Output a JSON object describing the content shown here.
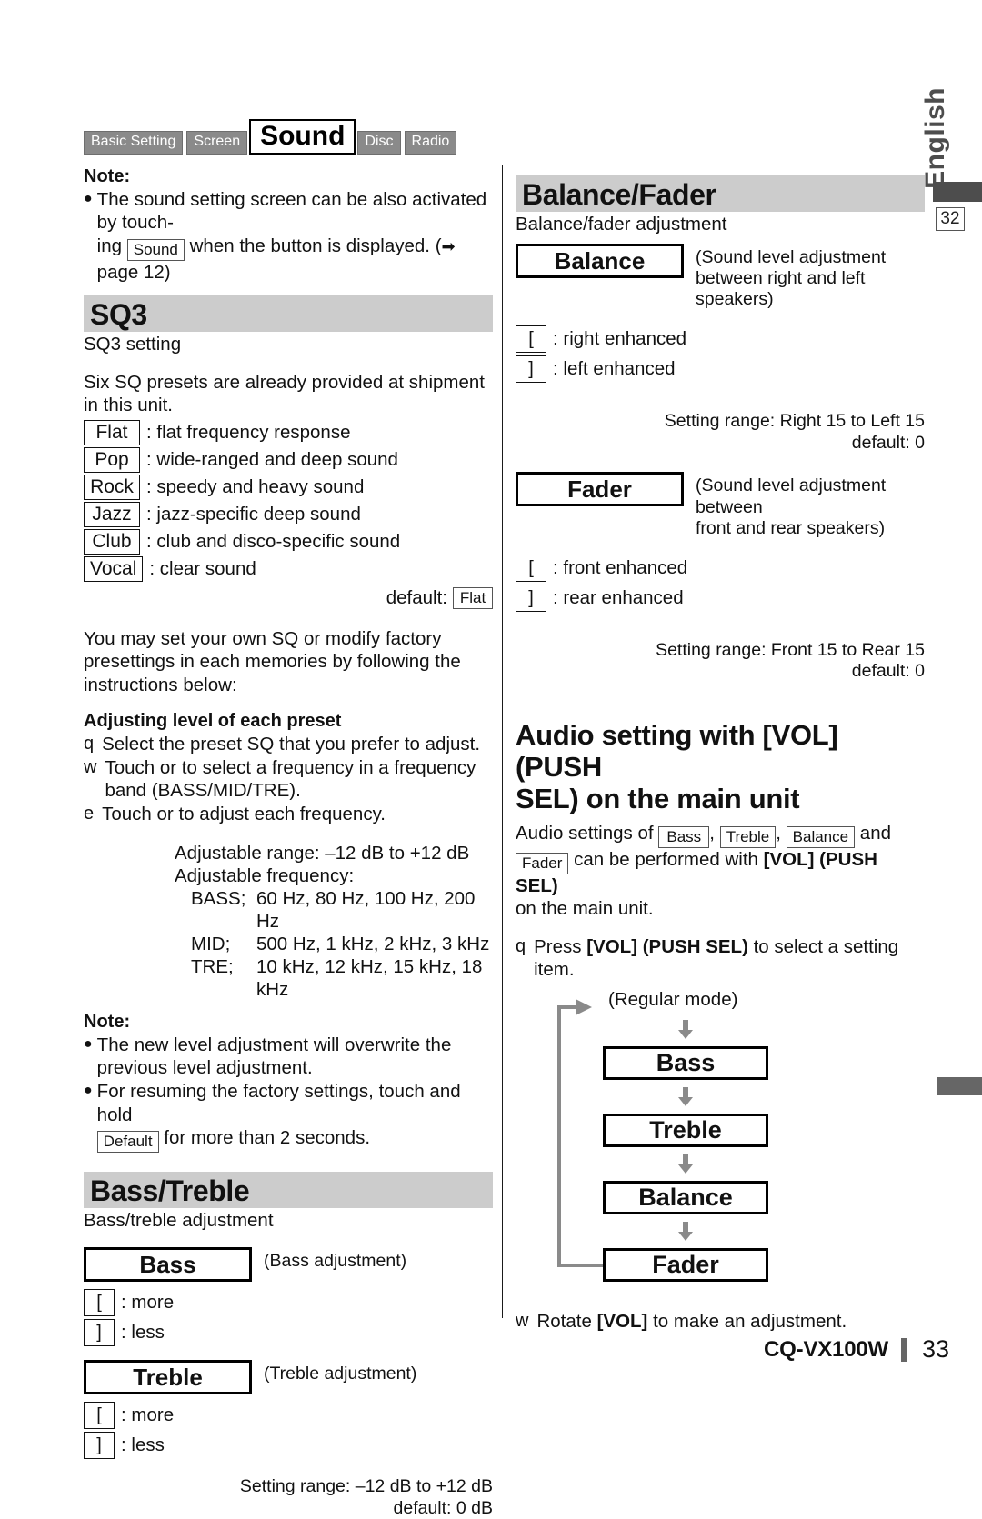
{
  "edge": {
    "language_label": "English",
    "page_ref_box": "32"
  },
  "nav_tabs": [
    {
      "label": "Basic Setting",
      "active": false
    },
    {
      "label": "Screen",
      "active": false
    },
    {
      "label": "Sound",
      "active": true
    },
    {
      "label": "Disc",
      "active": false
    },
    {
      "label": "Radio",
      "active": false
    }
  ],
  "left_column": {
    "note_top": {
      "heading": "Note:",
      "bullet_part1": "The sound setting screen can be also activated by touch-",
      "bullet_part2_pre": "ing",
      "bullet_chip": "Sound",
      "bullet_part2_post": "when the button is displayed. (",
      "arrow_icon": "➡",
      "bullet_part2_end": "page 12)"
    },
    "sq3": {
      "title": "SQ3",
      "subtitle": "SQ3 setting",
      "intro": "Six SQ presets are already provided at shipment in this unit.",
      "presets": [
        {
          "key": "Flat",
          "desc": ": flat frequency response"
        },
        {
          "key": "Pop",
          "desc": ": wide-ranged and deep sound"
        },
        {
          "key": "Rock",
          "desc": ": speedy and heavy sound"
        },
        {
          "key": "Jazz",
          "desc": ": jazz-specific deep sound"
        },
        {
          "key": "Club",
          "desc": ": club and disco-specific sound"
        },
        {
          "key": "Vocal",
          "desc": ": clear sound"
        }
      ],
      "default_label": "default:",
      "default_value": "Flat",
      "own_sq_text": "You may set your own SQ or modify factory presettings in each memories by following the instructions below:",
      "adjust_heading": "Adjusting level of each preset",
      "steps": [
        {
          "num": "q",
          "text": "Select the preset SQ that you prefer to adjust."
        },
        {
          "num": "w",
          "text": "Touch            or            to select a frequency in a frequency band (BASS/MID/TRE)."
        },
        {
          "num": "e",
          "text": "Touch            or            to adjust each frequency."
        }
      ],
      "adjustable_range": "Adjustable range: –12 dB to +12 dB",
      "adjustable_frequency_label": "Adjustable frequency:",
      "freq_rows": [
        {
          "band": "BASS;",
          "values": "60 Hz, 80 Hz, 100 Hz, 200 Hz"
        },
        {
          "band": "MID;",
          "values": "500 Hz, 1 kHz, 2 kHz, 3 kHz"
        },
        {
          "band": "TRE;",
          "values": "10 kHz, 12 kHz, 15 kHz, 18 kHz"
        }
      ],
      "note_bottom": {
        "heading": "Note:",
        "bullet1": "The new level adjustment will overwrite the previous level adjustment.",
        "bullet2_pre": "For resuming the factory settings, touch and hold",
        "bullet2_chip": "Default",
        "bullet2_post": "for more than 2 seconds."
      }
    },
    "bass_treble": {
      "title": "Bass/Treble",
      "subtitle": "Bass/treble adjustment",
      "bass_button": "Bass",
      "bass_caption": "(Bass adjustment)",
      "bass_more": ": more",
      "bass_less": ": less",
      "treble_button": "Treble",
      "treble_caption": "(Treble adjustment)",
      "treble_more": ": more",
      "treble_less": ": less",
      "range_line1": "Setting range: –12 dB to +12 dB",
      "range_line2": "default: 0 dB",
      "up_glyph": "[",
      "down_glyph": "]"
    }
  },
  "right_column": {
    "balance_fader": {
      "title": "Balance/Fader",
      "subtitle": "Balance/fader adjustment",
      "balance_button": "Balance",
      "balance_caption_line1": "(Sound level adjustment",
      "balance_caption_line2": "between right and left speakers)",
      "balance_right": ": right enhanced",
      "balance_left": ": left enhanced",
      "balance_range_line1": "Setting range: Right 15 to Left 15",
      "balance_range_line2": "default: 0",
      "fader_button": "Fader",
      "fader_caption_line1": "(Sound level adjustment between",
      "fader_caption_line2": "front and rear speakers)",
      "fader_front": ": front enhanced",
      "fader_rear": ": rear enhanced",
      "fader_range_line1": "Setting range: Front 15 to Rear 15",
      "fader_range_line2": "default: 0",
      "up_glyph": "[",
      "down_glyph": "]"
    },
    "vol_section": {
      "title_line1": "Audio setting with [VOL] (PUSH",
      "title_line2": "SEL) on the main unit",
      "intro_pre": "Audio settings of",
      "chip_bass": "Bass",
      "comma1": ",",
      "chip_treble": "Treble",
      "comma2": ",",
      "chip_balance": "Balance",
      "intro_and": "and",
      "chip_fader": "Fader",
      "intro_mid": "can be performed with",
      "intro_bold": "[VOL] (PUSH SEL)",
      "intro_end": "on the main unit.",
      "step1_num": "q",
      "step1_pre": "Press",
      "step1_bold": "[VOL] (PUSH SEL)",
      "step1_post": "to select a setting item.",
      "regular_mode": "(Regular mode)",
      "flow_items": [
        "Bass",
        "Treble",
        "Balance",
        "Fader"
      ],
      "step2_num": "w",
      "step2_pre": "Rotate",
      "step2_bold": "[VOL]",
      "step2_post": "to make an adjustment."
    }
  },
  "footer": {
    "model": "CQ-VX100W",
    "page_number": "33"
  },
  "colors": {
    "section_bar": "#cccccc",
    "tab_inactive": "#8a8a8a",
    "edge_gray": "#4d4d4d",
    "flow_arrow": "#8a8a8a"
  }
}
